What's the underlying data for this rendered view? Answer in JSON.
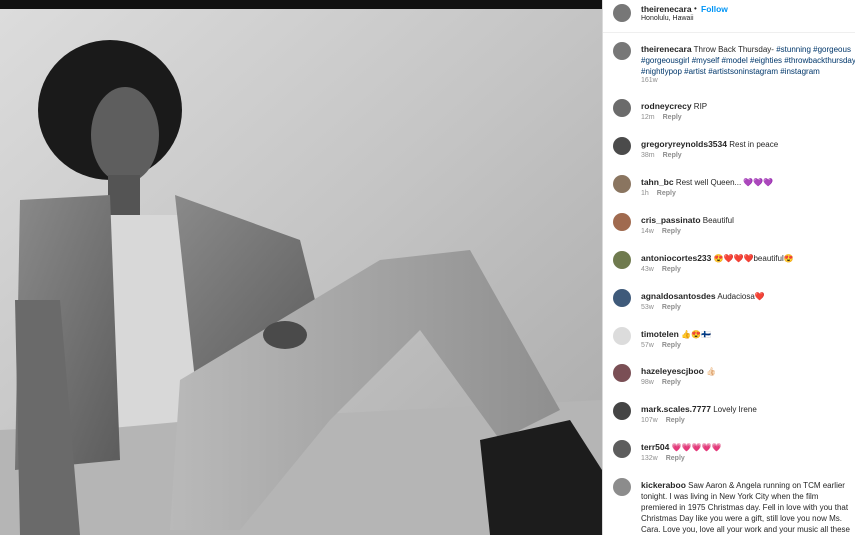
{
  "post": {
    "username": "theirenecara",
    "dot": "•",
    "follow_label": "Follow",
    "location": "Honolulu, Hawaii"
  },
  "caption": {
    "username": "theirenecara",
    "text": "Throw Back Thursday-",
    "tags": [
      "#stunning",
      "#gorgeous",
      "#gorgeousgirl",
      "#myself",
      "#model",
      "#eighties",
      "#throwbackthursday",
      "#nightlypop",
      "#artist",
      "#artistsoninstagram",
      "#instagram"
    ],
    "time": "161w"
  },
  "reply_label": "Reply",
  "comments": [
    {
      "username": "rodneycrecy",
      "text": "RIP",
      "time": "12m"
    },
    {
      "username": "gregoryreynolds3534",
      "text": "Rest in peace",
      "time": "38m"
    },
    {
      "username": "tahn_bc",
      "text": "Rest well Queen... 💜💜💜",
      "time": "1h"
    },
    {
      "username": "cris_passinato",
      "text": "Beautiful",
      "time": "14w"
    },
    {
      "username": "antoniocortes233",
      "text": "😍❤️❤️❤️beautiful😍",
      "time": "43w"
    },
    {
      "username": "agnaldosantosdes",
      "text": "Audaciosa❤️",
      "time": "53w"
    },
    {
      "username": "timotelen",
      "text": "👍😍🇫🇮",
      "time": "57w"
    },
    {
      "username": "hazeleyescjboo",
      "text": "👍🏻",
      "time": "98w"
    },
    {
      "username": "mark.scales.7777",
      "text": "Lovely Irene",
      "time": "107w"
    },
    {
      "username": "terr504",
      "text": "💗💗💗💗💗",
      "time": "132w"
    },
    {
      "username": "kickeraboo",
      "text": "Saw Aaron & Angela running on TCM earlier tonight. I was living in New York City when the film premiered in 1975 Christmas day. Fell in love with you that Christmas Day like you were a gift, still love you now Ms. Cara. Love you, love all your work and your music all these"
    }
  ]
}
